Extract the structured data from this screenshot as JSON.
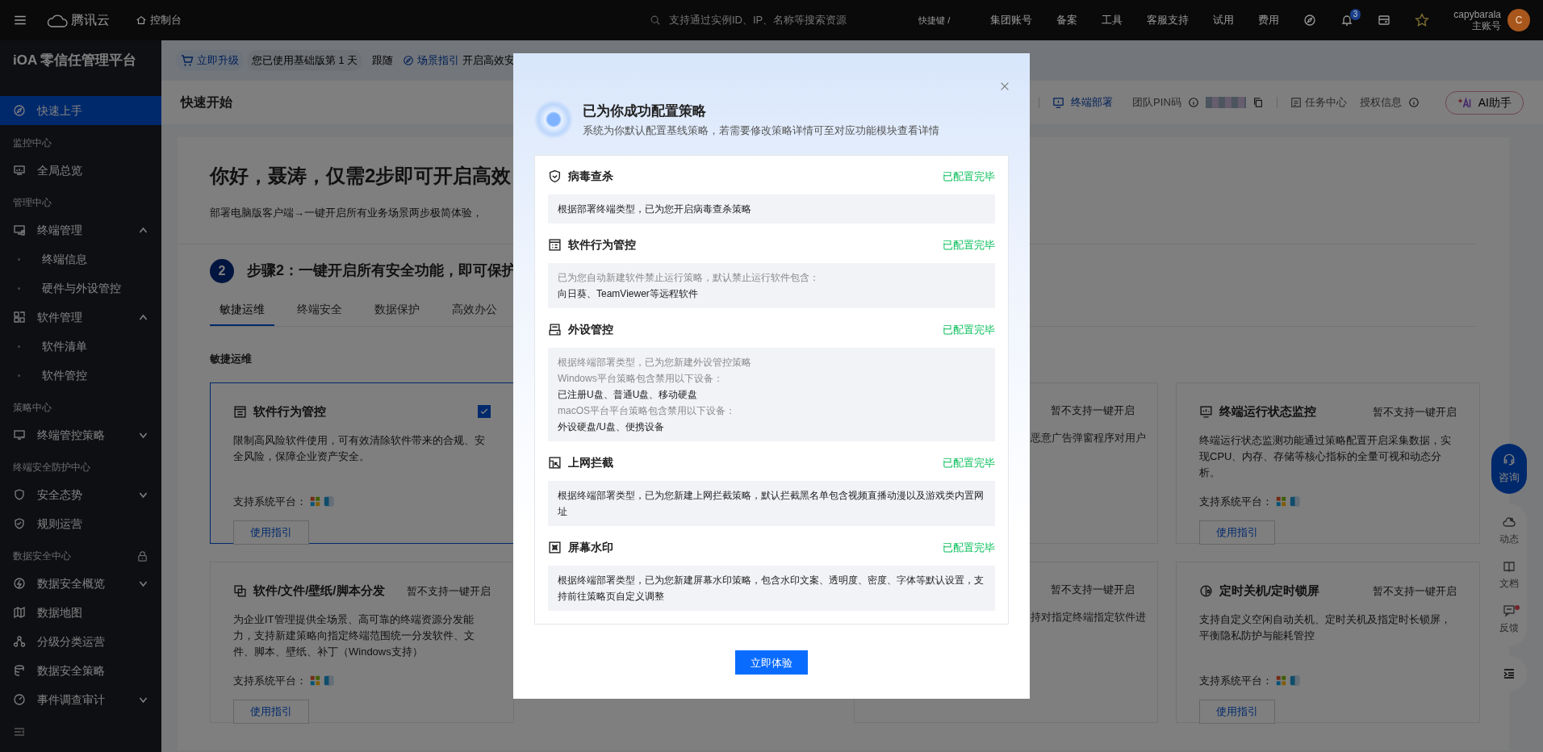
{
  "top_bar": {
    "brand": "腾讯云",
    "console": "控制台",
    "search": {
      "placeholder": "支持通过实例ID、IP、名称等搜索资源"
    },
    "shortcut": "快捷键 /",
    "links": [
      "集团账号",
      "备案",
      "工具",
      "客服支持",
      "试用",
      "费用"
    ],
    "notification_count": "3",
    "user": {
      "name": "capybarala",
      "role": "主账号",
      "avatar": "C"
    }
  },
  "sidebar": {
    "title": "iOA 零信任管理平台",
    "items": [
      {
        "kind": "link",
        "label": "快速上手",
        "selected": true
      },
      {
        "kind": "heading",
        "label": "监控中心"
      },
      {
        "kind": "link",
        "label": "全局总览",
        "selected": false
      },
      {
        "kind": "heading",
        "label": "管理中心"
      },
      {
        "kind": "link",
        "label": "终端管理",
        "selected": false,
        "expanded": true,
        "children": [
          {
            "label": "终端信息",
            "selected": false
          },
          {
            "label": "硬件与外设管控",
            "selected": false
          }
        ]
      },
      {
        "kind": "link",
        "label": "软件管理",
        "selected": false,
        "expanded": true,
        "children": [
          {
            "label": "软件清单",
            "selected": false
          },
          {
            "label": "软件管控",
            "selected": false
          }
        ]
      },
      {
        "kind": "heading",
        "label": "策略中心"
      },
      {
        "kind": "link",
        "label": "终端管控策略",
        "selected": false,
        "expanded": false
      },
      {
        "kind": "heading",
        "label": "终端安全防护中心"
      },
      {
        "kind": "link",
        "label": "安全态势",
        "selected": false,
        "expanded": false
      },
      {
        "kind": "link",
        "label": "规则运营",
        "selected": false
      },
      {
        "kind": "heading",
        "label": "数据安全中心",
        "locked": true
      },
      {
        "kind": "link",
        "label": "数据安全概览",
        "selected": false,
        "expanded": false
      },
      {
        "kind": "link",
        "label": "数据地图",
        "selected": false
      },
      {
        "kind": "link",
        "label": "分级分类运营",
        "selected": false
      },
      {
        "kind": "link",
        "label": "数据安全策略",
        "selected": false
      },
      {
        "kind": "link",
        "label": "事件调查审计",
        "selected": false,
        "expanded": false
      }
    ]
  },
  "sub_bar": {
    "upgrade": "立即升级",
    "usage": "您已使用基础版第 1 天",
    "follow": "跟随",
    "guide": "场景指引",
    "guide_hint": "开启高效安"
  },
  "header": {
    "title": "快速开始",
    "deploy": "终端部署",
    "pin_label": "团队PIN码",
    "tasks": "任务中心",
    "license": "授权信息",
    "ai": "AI助手"
  },
  "hero": {
    "greeting": "你好，聂涛，仅需2步即可开启高效",
    "subtitle": "部署电脑版客户端→一键开启所有业务场景两步极简体验，"
  },
  "step": {
    "number": "2",
    "title": "步骤2：一键开启所有安全功能，即可保护"
  },
  "tabs": [
    {
      "label": "敏捷运维",
      "selected": true
    },
    {
      "label": "终端安全",
      "selected": false
    },
    {
      "label": "数据保护",
      "selected": false
    },
    {
      "label": "高效办公",
      "selected": false
    }
  ],
  "section_label": "敏捷运维",
  "cards": [
    {
      "kind": "full",
      "title": "软件行为管控",
      "checked": true,
      "description": "限制高风险软件使用，可有效清除软件带来的合规、安全风险，保障企业资产安全。",
      "platforms_label": "支持系统平台：",
      "guide": "使用指引"
    },
    {
      "kind": "clipped",
      "status": "暂不支持一键开启",
      "description": "恶意广告弹窗程序对用户"
    },
    {
      "kind": "full",
      "title": "终端运行状态监控",
      "status": "暂不支持一键开启",
      "description": "终端运行状态监测功能通过策略配置开启采集数据，实现CPU、内存、存储等核心指标的全量可视和动态分析。",
      "platforms_label": "支持系统平台：",
      "guide": "使用指引"
    },
    {
      "kind": "full",
      "title": "软件/文件/壁纸/脚本分发",
      "status": "暂不支持一键开启",
      "description": "为企业IT管理提供全场景、高可靠的终端资源分发能力，支持新建策略向指定终端范围统一分发软件、文件、脚本、壁纸、补丁（Windows支持）",
      "platforms_label": "支持系统平台：",
      "guide": "使用指引"
    },
    {
      "kind": "clipped",
      "status": "暂不支持一键开启",
      "description": "持对指定终端指定软件进"
    },
    {
      "kind": "full",
      "title": "定时关机/定时锁屏",
      "status": "暂不支持一键开启",
      "description": "支持自定义空闲自动关机、定时关机及指定时长锁屏，平衡隐私防护与能耗管控",
      "platforms_label": "支持系统平台：",
      "guide": "使用指引"
    }
  ],
  "float_toolbar": {
    "consult": "咨询",
    "items": [
      {
        "label": "动态",
        "unread": false
      },
      {
        "label": "文档",
        "unread": false
      },
      {
        "label": "反馈",
        "unread": true
      }
    ]
  },
  "modal": {
    "title": "已为你成功配置策略",
    "subtitle": "系统为你默认配置基线策略，若需要修改策略详情可至对应功能模块查看详情",
    "policies": [
      {
        "title": "病毒查杀",
        "status": "已配置完毕",
        "lines": [
          {
            "text": "根据部署终端类型，已为您开启病毒查杀策略",
            "muted": false
          }
        ]
      },
      {
        "title": "软件行为管控",
        "status": "已配置完毕",
        "lines": [
          {
            "text": "已为您自动新建软件禁止运行策略，默认禁止运行软件包含：",
            "muted": true
          },
          {
            "text": "向日葵、TeamViewer等远程软件",
            "muted": false
          }
        ]
      },
      {
        "title": "外设管控",
        "status": "已配置完毕",
        "lines": [
          {
            "text": "根据终端部署类型，已为您新建外设管控策略",
            "muted": true
          },
          {
            "text": "Windows平台策略包含禁用以下设备：",
            "muted": true
          },
          {
            "text": "已注册U盘、普通U盘、移动硬盘",
            "muted": false
          },
          {
            "text": "macOS平台平台策略包含禁用以下设备：",
            "muted": true
          },
          {
            "text": "外设硬盘/U盘、便携设备",
            "muted": false
          }
        ]
      },
      {
        "title": "上网拦截",
        "status": "已配置完毕",
        "lines": [
          {
            "text": "根据终端部署类型，已为您新建上网拦截策略，默认拦截黑名单包含视频直播动漫以及游戏类内置网址",
            "muted": false
          }
        ]
      },
      {
        "title": "屏幕水印",
        "status": "已配置完毕",
        "lines": [
          {
            "text": "根据终端部署类型，已为您新建屏幕水印策略，包含水印文案、透明度、密度、字体等默认设置，支持前往策略页自定义调整",
            "muted": false
          }
        ]
      }
    ],
    "confirm": "立即体验"
  }
}
